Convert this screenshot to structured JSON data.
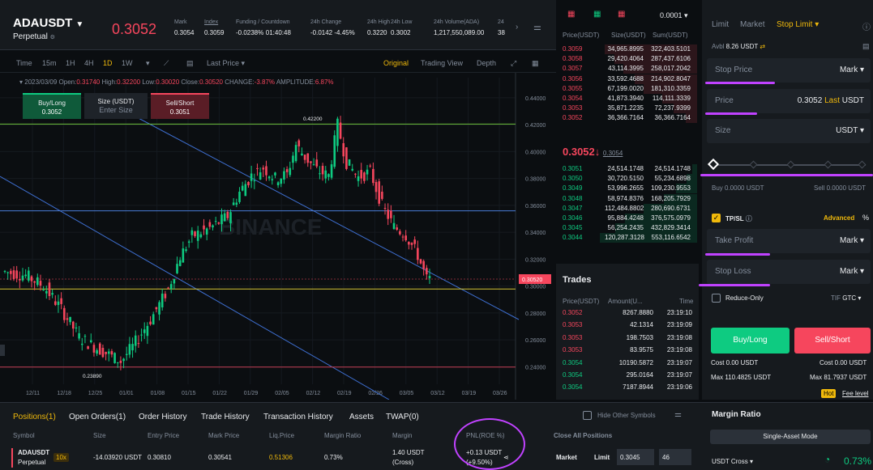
{
  "header": {
    "symbol": "ADAUSDT",
    "contract": "Perpetual",
    "last_price": "0.3052",
    "stats": [
      {
        "label": "Mark",
        "value": "0.3054"
      },
      {
        "label": "Index",
        "value": "0.3059"
      },
      {
        "label": "Funding / Countdown",
        "value_a": "-0.0238%",
        "value_b": "01:40:48"
      },
      {
        "label": "24h Change",
        "value": "-0.0142 -4.45%"
      },
      {
        "label": "24h High",
        "value": "0.3220"
      },
      {
        "label": "24h Low",
        "value": "0.3002"
      },
      {
        "label": "24h Volume(ADA)",
        "value": "1,217,550,089.00"
      },
      {
        "label": "24",
        "value": "38"
      }
    ]
  },
  "chart_toolbar": {
    "intervals": [
      "Time",
      "15m",
      "1H",
      "4H",
      "1D",
      "1W"
    ],
    "active_interval": "1D",
    "price_type": "Last Price ▾",
    "views": [
      "Original",
      "Trading View",
      "Depth"
    ],
    "active_view": "Original"
  },
  "ohlc": {
    "date": "2023/03/09",
    "open_label": "Open:",
    "open": "0.31740",
    "high_label": "High:",
    "high": "0.32200",
    "low_label": "Low:",
    "low": "0.30020",
    "close_label": "Close:",
    "close": "0.30520",
    "change_label": "CHANGE:",
    "change": "-3.87%",
    "amp_label": "AMPLITUDE:",
    "amp": "6.87%"
  },
  "quick_order": {
    "buy_label": "Buy/Long",
    "buy_price": "0.3052",
    "size_label": "Size (USDT)",
    "size_placeholder": "Enter Size",
    "sell_label": "Sell/Short",
    "sell_price": "0.3051"
  },
  "chart_data": {
    "type": "candlestick",
    "x_ticks": [
      "12/11",
      "12/18",
      "12/25",
      "01/01",
      "01/08",
      "01/15",
      "01/22",
      "01/29",
      "02/05",
      "02/12",
      "02/19",
      "02/26",
      "03/05",
      "03/12",
      "03/19",
      "03/26"
    ],
    "y_ticks": [
      "0.44000",
      "0.42000",
      "0.40000",
      "0.38000",
      "0.36000",
      "0.34000",
      "0.32000",
      "0.30000",
      "0.28000",
      "0.26000",
      "0.24000"
    ],
    "ylim": [
      0.227,
      0.455
    ],
    "current_price_label": "0.30520",
    "high_annotation": "0.42200",
    "low_annotation": "0.23890",
    "horizontal_levels": [
      {
        "value": 0.4205,
        "color": "#6bbf3a"
      },
      {
        "value": 0.356,
        "color": "#4a7dd8"
      },
      {
        "value": 0.2978,
        "color": "#d6c634"
      },
      {
        "value": 0.2398,
        "color": "#c43d52"
      }
    ],
    "watermark": "BINANCE"
  },
  "order_book": {
    "tick": "0.0001 ▾",
    "columns": [
      "Price(USDT)",
      "Size(USDT)",
      "Sum(USDT)"
    ],
    "asks": [
      {
        "p": "0.3059",
        "s": "34,965.8995",
        "sum": "322,403.5101",
        "d": 0.95
      },
      {
        "p": "0.3058",
        "s": "29,420.4064",
        "sum": "287,437.6106",
        "d": 0.85
      },
      {
        "p": "0.3057",
        "s": "43,114.3995",
        "sum": "258,017.2042",
        "d": 0.76
      },
      {
        "p": "0.3056",
        "s": "33,592.4688",
        "sum": "214,902.8047",
        "d": 0.64
      },
      {
        "p": "0.3055",
        "s": "67,199.0020",
        "sum": "181,310.3359",
        "d": 0.55
      },
      {
        "p": "0.3054",
        "s": "41,873.3940",
        "sum": "114,111.3339",
        "d": 0.36
      },
      {
        "p": "0.3053",
        "s": "35,871.2235",
        "sum": "72,237.9399",
        "d": 0.24
      },
      {
        "p": "0.3052",
        "s": "36,366.7164",
        "sum": "36,366.7164",
        "d": 0.12
      }
    ],
    "mid_price": "0.3052",
    "mid_arrow": "↓",
    "mid_mark": "0.3054",
    "bids": [
      {
        "p": "0.3051",
        "s": "24,514.1748",
        "sum": "24,514.1748",
        "d": 0.05
      },
      {
        "p": "0.3050",
        "s": "30,720.5150",
        "sum": "55,234.6898",
        "d": 0.11
      },
      {
        "p": "0.3049",
        "s": "53,996.2655",
        "sum": "109,230.9553",
        "d": 0.22
      },
      {
        "p": "0.3048",
        "s": "58,974.8376",
        "sum": "168,205.7929",
        "d": 0.34
      },
      {
        "p": "0.3047",
        "s": "112,484.8802",
        "sum": "280,690.6731",
        "d": 0.55
      },
      {
        "p": "0.3046",
        "s": "95,884.4248",
        "sum": "376,575.0979",
        "d": 0.74
      },
      {
        "p": "0.3045",
        "s": "56,254.2435",
        "sum": "432,829.3414",
        "d": 0.84
      },
      {
        "p": "0.3044",
        "s": "120,287.3128",
        "sum": "553,116.6542",
        "d": 1.0
      }
    ]
  },
  "trades": {
    "title": "Trades",
    "columns": [
      "Price(USDT)",
      "Amount(U...",
      "Time"
    ],
    "rows": [
      {
        "p": "0.3052",
        "a": "8267.8880",
        "t": "23:19:10",
        "side": "red"
      },
      {
        "p": "0.3053",
        "a": "42.1314",
        "t": "23:19:09",
        "side": "red"
      },
      {
        "p": "0.3053",
        "a": "198.7503",
        "t": "23:19:08",
        "side": "red"
      },
      {
        "p": "0.3053",
        "a": "83.9575",
        "t": "23:19:08",
        "side": "red"
      },
      {
        "p": "0.3054",
        "a": "10190.5872",
        "t": "23:19:07",
        "side": "green"
      },
      {
        "p": "0.3054",
        "a": "295.0164",
        "t": "23:19:07",
        "side": "green"
      },
      {
        "p": "0.3054",
        "a": "7187.8944",
        "t": "23:19:06",
        "side": "green"
      }
    ]
  },
  "order_panel": {
    "tabs": [
      "Limit",
      "Market",
      "Stop Limit ▾"
    ],
    "active_tab": "Stop Limit ▾",
    "avbl_label": "Avbl",
    "avbl_value": "8.26 USDT",
    "stop_price": {
      "label": "Stop Price",
      "right": "Mark ▾"
    },
    "price": {
      "label": "Price",
      "value": "0.3052",
      "tag": "Last",
      "unit": "USDT"
    },
    "size": {
      "label": "Size",
      "unit": "USDT ▾"
    },
    "slider_percent": 0,
    "buy_info": "Buy 0.0000 USDT",
    "sell_info": "Sell 0.0000 USDT",
    "tpsl_label": "TP/SL",
    "advanced_label": "Advanced",
    "take_profit": {
      "label": "Take Profit",
      "right": "Mark ▾"
    },
    "stop_loss": {
      "label": "Stop Loss",
      "right": "Mark ▾"
    },
    "reduce_only": "Reduce-Only",
    "tif_label": "TIF",
    "tif_value": "GTC ▾",
    "buy_button": "Buy/Long",
    "sell_button": "Sell/Short",
    "cost_buy": "Cost 0.00 USDT",
    "cost_sell": "Cost 0.00 USDT",
    "max_buy": "Max 110.4825 USDT",
    "max_sell": "Max 81.7937 USDT",
    "hot_tag": "Hot",
    "fee_level": "Fee level"
  },
  "positions": {
    "tabs": [
      "Positions(1)",
      "Open Orders(1)",
      "Order History",
      "Trade History",
      "Transaction History",
      "Assets",
      "TWAP(0)"
    ],
    "active_tab": "Positions(1)",
    "hide_other": "Hide Other Symbols",
    "columns": [
      "Symbol",
      "Size",
      "Entry Price",
      "Mark Price",
      "Liq.Price",
      "Margin Ratio",
      "Margin",
      "PNL(ROE %)",
      "Close All Positions"
    ],
    "row": {
      "symbol": "ADAUSDT",
      "contract": "Perpetual",
      "leverage": "10x",
      "size": "-14.03920 USDT",
      "entry": "0.30810",
      "mark": "0.30541",
      "liq": "0.51306",
      "margin_ratio": "0.73%",
      "margin": "1.40 USDT",
      "margin_mode": "(Cross)",
      "pnl": "+0.13 USDT",
      "roe": "(+9.50%)",
      "close_market": "Market",
      "close_limit": "Limit",
      "close_price": "0.3045",
      "close_qty": "46"
    }
  },
  "margin_ratio": {
    "title": "Margin Ratio",
    "mode": "Single-Asset Mode",
    "account": "USDT Cross ▾",
    "value": "0.73%"
  },
  "colors": {
    "green": "#0ecb81",
    "red": "#f6465d",
    "gold": "#f0b90b",
    "highlight": "#c042ff"
  }
}
